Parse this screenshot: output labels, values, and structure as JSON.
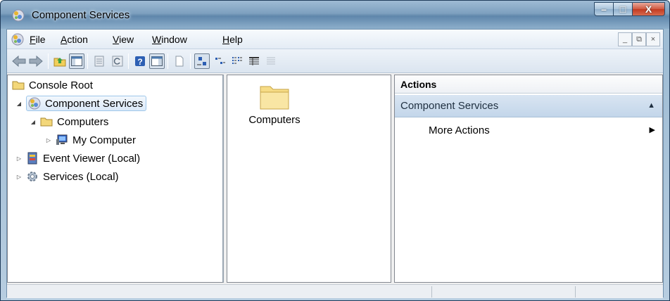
{
  "window": {
    "title": "Component Services",
    "controls": {
      "minimize": "–",
      "maximize": "□",
      "close": "X"
    }
  },
  "menubar": {
    "items": [
      {
        "label_prefix": "",
        "label_u": "F",
        "label_rest": "ile"
      },
      {
        "label_prefix": "",
        "label_u": "A",
        "label_rest": "ction"
      },
      {
        "label_prefix": "",
        "label_u": "V",
        "label_rest": "iew"
      },
      {
        "label_prefix": "",
        "label_u": "W",
        "label_rest": "indow"
      },
      {
        "label_prefix": "",
        "label_u": "H",
        "label_rest": "elp"
      }
    ],
    "mdi_controls": {
      "minimize": "_",
      "restore": "⧉",
      "close": "×"
    }
  },
  "toolbar": {
    "buttons": [
      "back",
      "forward",
      "up-folder",
      "show-hide-console-tree",
      "properties",
      "refresh",
      "help",
      "show-hide-action-pane",
      "new-window",
      "large-icons",
      "small-icons",
      "list",
      "detail",
      "filter"
    ]
  },
  "tree": {
    "items": [
      {
        "label": "Console Root",
        "icon": "folder-icon"
      },
      {
        "label": "Component Services",
        "icon": "component-services-icon",
        "expanded": true,
        "selected": true
      },
      {
        "label": "Computers",
        "icon": "folder-icon",
        "expanded": true
      },
      {
        "label": "My Computer",
        "icon": "computer-icon",
        "expanded": false
      },
      {
        "label": "Event Viewer (Local)",
        "icon": "event-viewer-icon",
        "expanded": false
      },
      {
        "label": "Services (Local)",
        "icon": "gear-icon",
        "expanded": false
      }
    ]
  },
  "list": {
    "items": [
      {
        "label": "Computers",
        "icon": "folder-icon"
      }
    ]
  },
  "actions": {
    "header": "Actions",
    "group": {
      "label": "Component Services",
      "caret": "▲"
    },
    "items": [
      {
        "label": "More Actions",
        "arrow": "▶"
      }
    ]
  },
  "colors": {
    "selection": "#dbe9f8",
    "actions_group": "#c3d6ea",
    "folder": "#f3d77a"
  }
}
